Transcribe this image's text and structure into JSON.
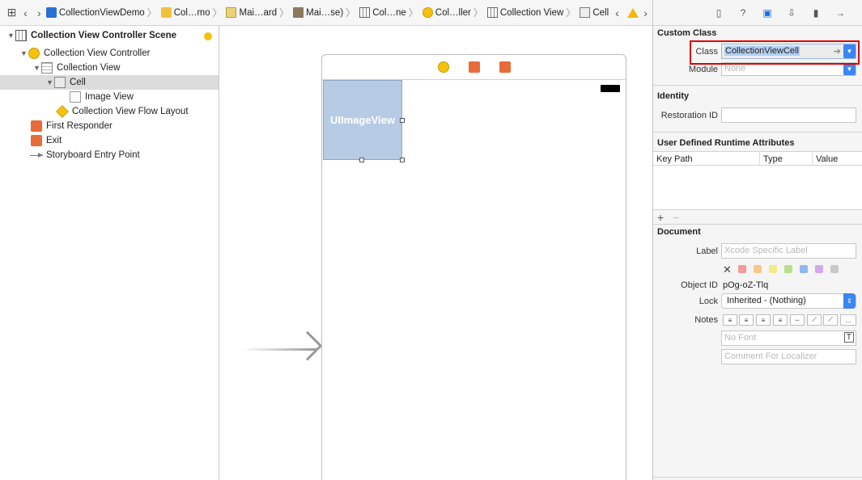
{
  "jumpbar": {
    "crumbs": [
      "CollectionViewDemo",
      "Col…mo",
      "Mai…ard",
      "Mai…se)",
      "Col…ne",
      "Col…ller",
      "Collection View",
      "Cell"
    ]
  },
  "outline": {
    "items": [
      {
        "label": "Collection View Controller Scene"
      },
      {
        "label": "Collection View Controller"
      },
      {
        "label": "Collection View"
      },
      {
        "label": "Cell"
      },
      {
        "label": "Image View"
      },
      {
        "label": "Collection View Flow Layout"
      },
      {
        "label": "First Responder"
      },
      {
        "label": "Exit"
      },
      {
        "label": "Storyboard Entry Point"
      }
    ]
  },
  "canvas": {
    "cell_label": "UIImageView"
  },
  "inspector": {
    "custom_class": {
      "title": "Custom Class",
      "class_label": "Class",
      "class_value": "CollectionViewCell",
      "module_label": "Module",
      "module_placeholder": "None"
    },
    "identity": {
      "title": "Identity",
      "restoration_label": "Restoration ID",
      "restoration_value": ""
    },
    "runtime": {
      "title": "User Defined Runtime Attributes",
      "columns": [
        "Key Path",
        "Type",
        "Value"
      ],
      "add": "+",
      "remove": "−"
    },
    "document": {
      "title": "Document",
      "label_label": "Label",
      "label_placeholder": "Xcode Specific Label",
      "object_id_label": "Object ID",
      "object_id_value": "pOg-oZ-Tlq",
      "lock_label": "Lock",
      "lock_value": "Inherited - (Nothing)",
      "notes_label": "Notes",
      "font_placeholder": "No Font",
      "comment_placeholder": "Comment For Localizer",
      "notes_more": "…"
    },
    "swatch_colors": [
      "#f19a9a",
      "#f7c78a",
      "#f2ea86",
      "#b8e08a",
      "#8fb8f2",
      "#d3a7ee",
      "#c9c9c9"
    ]
  }
}
